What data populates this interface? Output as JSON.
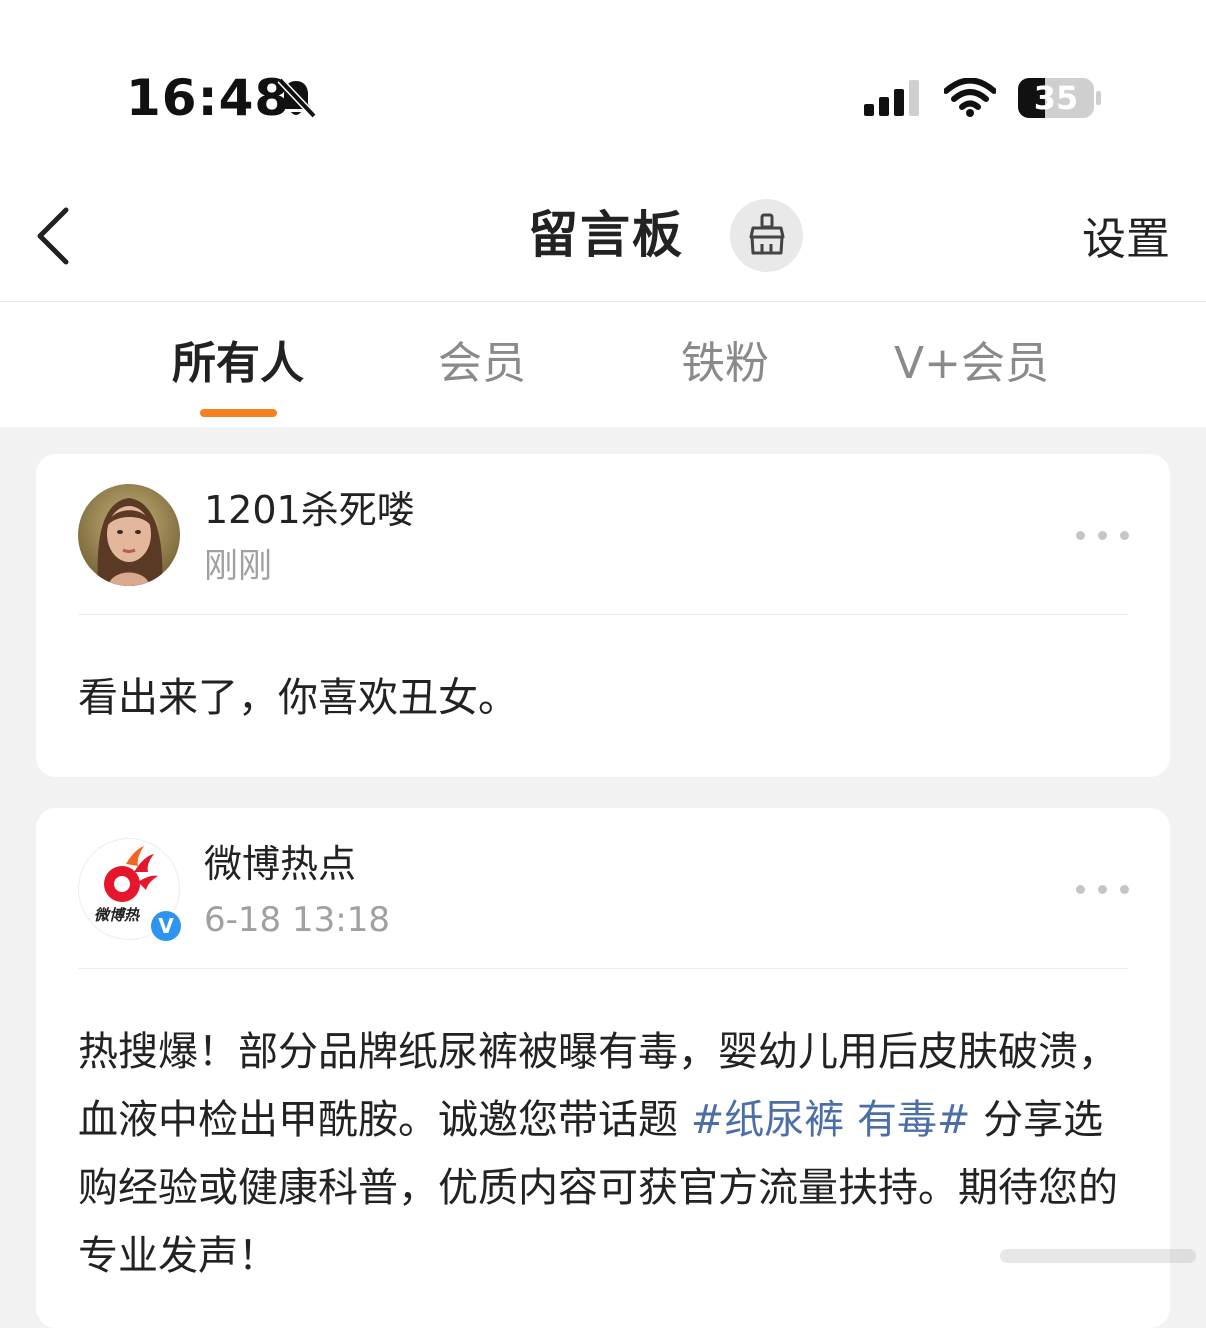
{
  "status_bar": {
    "time": "16:48",
    "battery_level": "35",
    "icons": [
      "bell-muted-icon",
      "cellular-signal-icon",
      "wifi-icon",
      "battery-icon"
    ]
  },
  "header": {
    "title": "留言板",
    "settings_label": "设置",
    "icons": [
      "back-arrow-icon",
      "brush-icon"
    ]
  },
  "tabs": [
    {
      "label": "所有人",
      "active": true
    },
    {
      "label": "会员",
      "active": false
    },
    {
      "label": "铁粉",
      "active": false
    },
    {
      "label": "V+会员",
      "active": false
    }
  ],
  "colors": {
    "accent": "#f5821f",
    "topic_link": "#4b6ea6",
    "verified_badge": "#2d95f0",
    "background": "#f2f2f2"
  },
  "messages": [
    {
      "username": "1201杀死喽",
      "time": "刚刚",
      "content": "看出来了，你喜欢丑女。"
    },
    {
      "username": "微博热点",
      "time": "6-18 13:18",
      "verified": true,
      "avatar_text": "微博热",
      "content_parts": {
        "before": "热搜爆！部分品牌纸尿裤被曝有毒，婴幼儿用后皮肤破溃，血液中检出甲酰胺。诚邀您带话题 ",
        "topic": "#纸尿裤 有毒#",
        "after": " 分享选购经验或健康科普，优质内容可获官方流量扶持。期待您的专业发声！"
      }
    }
  ]
}
